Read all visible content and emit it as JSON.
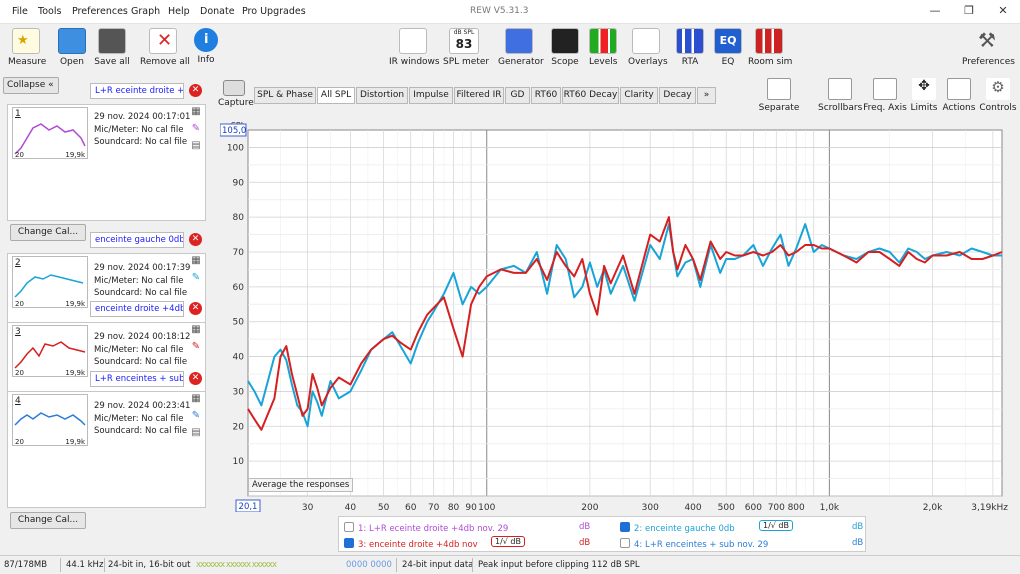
{
  "menu": [
    "File",
    "Tools",
    "Preferences",
    "Graph",
    "Help",
    "Donate",
    "Pro Upgrades"
  ],
  "window_title": "REW V5.31.3",
  "toolbar_left": [
    "Measure",
    "Open",
    "Save all",
    "Remove all",
    "Info"
  ],
  "toolbar_mid": [
    "IR windows",
    "SPL meter",
    "Generator",
    "Scope",
    "Levels",
    "Overlays",
    "RTA",
    "EQ",
    "Room sim"
  ],
  "spl_meter": {
    "unit": "dB SPL",
    "value": "83"
  },
  "toolbar_right": "Preferences",
  "collapse": "Collapse",
  "measurements": [
    {
      "num": "1",
      "name": "L+R eceinte droite +4",
      "date": "29 nov. 2024 00:17:01",
      "mic": "Mic/Meter: No cal file",
      "sound": "Soundcard: No cal file",
      "fmin": "20",
      "fmax": "19,9k",
      "color": "#b04bd8"
    },
    {
      "num": "2",
      "name": "enceinte gauche 0db",
      "date": "29 nov. 2024 00:17:39",
      "mic": "Mic/Meter: No cal file",
      "sound": "Soundcard: No cal file",
      "fmin": "20",
      "fmax": "19,9k",
      "color": "#19a4d8"
    },
    {
      "num": "3",
      "name": "enceinte droite +4db",
      "date": "29 nov. 2024 00:18:12",
      "mic": "Mic/Meter: No cal file",
      "sound": "Soundcard: No cal file",
      "fmin": "20",
      "fmax": "19,9k",
      "color": "#d42020"
    },
    {
      "num": "4",
      "name": "L+R enceintes + sub",
      "date": "29 nov. 2024 00:23:41",
      "mic": "Mic/Meter: No cal file",
      "sound": "Soundcard: No cal file",
      "fmin": "20",
      "fmax": "19,9k",
      "color": "#2b7bd6"
    }
  ],
  "change_cal": "Change Cal...",
  "capture": "Capture",
  "tabs": [
    "SPL & Phase",
    "All SPL",
    "Distortion",
    "Impulse",
    "Filtered IR",
    "GD",
    "RT60",
    "RT60 Decay",
    "Clarity",
    "Decay",
    "»"
  ],
  "right_tools": [
    "Separate",
    "Scrollbars",
    "Freq. Axis",
    "Limits",
    "Actions",
    "Controls"
  ],
  "chart_data": {
    "type": "line",
    "ylabel": "SPL",
    "ylim": [
      0,
      105
    ],
    "yticks": [
      "100",
      "90",
      "80",
      "70",
      "60",
      "50",
      "40",
      "30",
      "20",
      "10"
    ],
    "xlim": [
      20.1,
      3190
    ],
    "xticks": [
      {
        "v": 30,
        "l": "30"
      },
      {
        "v": 40,
        "l": "40"
      },
      {
        "v": 50,
        "l": "50"
      },
      {
        "v": 60,
        "l": "60"
      },
      {
        "v": 70,
        "l": "70"
      },
      {
        "v": 80,
        "l": "80"
      },
      {
        "v": 90,
        "l": "90"
      },
      {
        "v": 100,
        "l": "100"
      },
      {
        "v": 200,
        "l": "200"
      },
      {
        "v": 300,
        "l": "300"
      },
      {
        "v": 400,
        "l": "400"
      },
      {
        "v": 500,
        "l": "500"
      },
      {
        "v": 600,
        "l": "600"
      },
      {
        "v": 700,
        "l": "700"
      },
      {
        "v": 800,
        "l": "800"
      },
      {
        "v": 1000,
        "l": "1,0k"
      },
      {
        "v": 2000,
        "l": "2,0k"
      },
      {
        "v": 3190,
        "l": "3,19kHz"
      }
    ],
    "ymax_label": "105,0",
    "xmin_label": "20,1",
    "x": [
      20,
      21,
      22,
      24,
      25,
      26,
      27,
      28,
      29,
      30,
      31,
      32,
      33,
      35,
      37,
      40,
      43,
      46,
      50,
      53,
      56,
      60,
      63,
      67,
      70,
      75,
      80,
      85,
      90,
      95,
      100,
      110,
      120,
      130,
      140,
      150,
      160,
      170,
      180,
      190,
      200,
      210,
      220,
      230,
      250,
      270,
      300,
      320,
      340,
      350,
      360,
      380,
      400,
      420,
      450,
      480,
      500,
      530,
      560,
      600,
      640,
      680,
      720,
      760,
      800,
      850,
      900,
      950,
      1000,
      1100,
      1200,
      1300,
      1400,
      1500,
      1600,
      1700,
      1800,
      1900,
      2000,
      2200,
      2400,
      2600,
      2800,
      3000,
      3190
    ],
    "series": [
      {
        "name": "enceinte gauche 0db",
        "color": "#19a4d8",
        "values": [
          33,
          30,
          26,
          40,
          42,
          39,
          32,
          26,
          24,
          20,
          30,
          27,
          23,
          33,
          28,
          30,
          36,
          42,
          45,
          47,
          43,
          38,
          44,
          50,
          53,
          58,
          64,
          55,
          60,
          58,
          60,
          65,
          66,
          64,
          70,
          58,
          72,
          68,
          57,
          60,
          67,
          60,
          65,
          58,
          66,
          56,
          72,
          68,
          78,
          70,
          63,
          67,
          68,
          60,
          72,
          64,
          68,
          68,
          69,
          72,
          66,
          71,
          75,
          66,
          71,
          78,
          70,
          72,
          71,
          69,
          68,
          70,
          71,
          70,
          67,
          71,
          70,
          68,
          69,
          70,
          69,
          71,
          70,
          69,
          69
        ]
      },
      {
        "name": "enceinte droite +4db",
        "color": "#d42020",
        "values": [
          25,
          22,
          19,
          28,
          40,
          43,
          35,
          29,
          23,
          25,
          35,
          31,
          26,
          31,
          34,
          32,
          38,
          42,
          45,
          46,
          44,
          42,
          47,
          52,
          54,
          57,
          48,
          40,
          55,
          60,
          63,
          65,
          64,
          64,
          68,
          62,
          70,
          66,
          63,
          68,
          58,
          52,
          66,
          61,
          69,
          58,
          75,
          73,
          80,
          70,
          65,
          72,
          68,
          62,
          73,
          68,
          70,
          69,
          69,
          70,
          69,
          70,
          72,
          69,
          70,
          72,
          72,
          71,
          71,
          69,
          67,
          70,
          70,
          68,
          66,
          70,
          68,
          67,
          69,
          69,
          70,
          68,
          68,
          69,
          70
        ]
      }
    ]
  },
  "average": "Average the responses",
  "legend": [
    {
      "check": false,
      "label": "1: L+R eceinte droite +4db nov. 29",
      "unit": "dB",
      "color": "#b04bd8"
    },
    {
      "check": true,
      "label": "2: enceinte gauche 0db",
      "unit": "dB",
      "color": "#19a4d8",
      "badge": "1/√ dB"
    },
    {
      "check": true,
      "label": "3: enceinte droite +4db nov",
      "unit": "dB",
      "color": "#d42020",
      "badge": "1/√ dB"
    },
    {
      "check": false,
      "label": "4: L+R enceintes + sub nov. 29",
      "unit": "dB",
      "color": "#2b7bd6"
    }
  ],
  "status": [
    "87/178MB",
    "44.1 kHz",
    "24-bit in, 16-bit out",
    "0000 0000",
    "24-bit input data",
    "Peak input before clipping 112 dB SPL"
  ]
}
